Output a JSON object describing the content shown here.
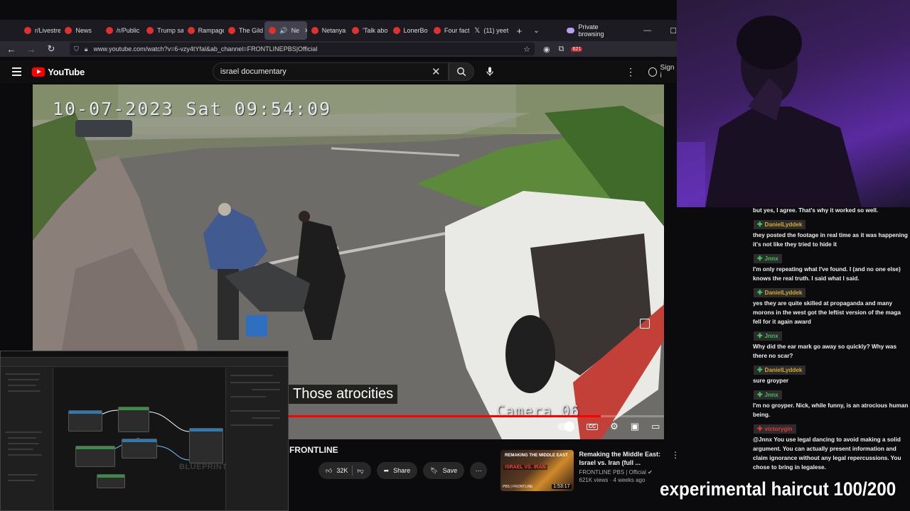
{
  "browser": {
    "tabs": [
      {
        "label": "r/Livestre",
        "active": false
      },
      {
        "label": "News",
        "active": false
      },
      {
        "label": "/r/Public",
        "active": false
      },
      {
        "label": "Trump sa",
        "active": false
      },
      {
        "label": "Rampage",
        "active": false
      },
      {
        "label": "The Gild",
        "active": false
      },
      {
        "label": "Ne",
        "active": true
      },
      {
        "label": "Netanya",
        "active": false
      },
      {
        "label": "'Talk abo",
        "active": false
      },
      {
        "label": "LonerBo",
        "active": false
      },
      {
        "label": "Four fact",
        "active": false
      },
      {
        "label": "(11) yeet",
        "active": false
      }
    ],
    "private_label": "Private browsing",
    "url": "www.youtube.com/watch?v=6-vzy4tYfal&ab_channel=FRONTLINEPBS|Official",
    "ext_badge": "621"
  },
  "youtube": {
    "logo_text": "YouTube",
    "search_value": "israel documentary",
    "signin_label": "Sign i"
  },
  "video": {
    "timestamp": "10-07-2023 Sat 09:54:09",
    "camera_label": "Camera 06",
    "caption": "Those atrocities",
    "progress": 0.9
  },
  "below_video": {
    "channel": "FRONTLINE",
    "like_count": "32K",
    "share_label": "Share",
    "save_label": "Save"
  },
  "recommendation": {
    "title": "Remaking the Middle East: Israel vs. Iran (full ...",
    "channel": "FRONTLINE PBS | Official",
    "meta": "621K views · 4 weeks ago",
    "duration": "1:53:17",
    "thumb_line1": "REMAKING THE MIDDLE EAST",
    "thumb_line2": "ISRAEL VS. IRAN",
    "thumb_brand": "PBS | FRONTLINE"
  },
  "editor": {
    "watermark": "BLUEPRINT"
  },
  "chat": {
    "top_message": "but yes, I agree. That's why it worked so well.",
    "messages": [
      {
        "user": "DanielLyddek",
        "color": "gold",
        "text": "they posted the footage in real time as it was happening it's not like they tried to hide it"
      },
      {
        "user": "Jnnx",
        "color": "green",
        "text": "I'm only repeating what I've found. I (and no one else) knows the real truth. I said what I said."
      },
      {
        "user": "DanielLyddek",
        "color": "gold",
        "text": "yes they are quite skilled at propaganda and many morons in the west got the leftist version of the maga fell for it again award"
      },
      {
        "user": "Jnnx",
        "color": "green",
        "text": "Why did the ear mark go away so quickly? Why was there no scar?"
      },
      {
        "user": "DanielLyddek",
        "color": "gold",
        "text": "sure groyper"
      },
      {
        "user": "Jnnx",
        "color": "green",
        "text": "I'm no groyper. Nick, while funny, is an atrocious human being."
      },
      {
        "user": "victorygin",
        "color": "red",
        "text": "@Jnnx You use legal dancing to avoid making a solid argument. You can actually present information and claim ignorance without any legal repercussions. You chose to bring in legalese."
      }
    ]
  },
  "overlay_text": "experimental haircut 100/200",
  "colors": {
    "youtube_red": "#ff0000",
    "chat_gold": "#d7a72e",
    "chat_green": "#41c15a"
  }
}
